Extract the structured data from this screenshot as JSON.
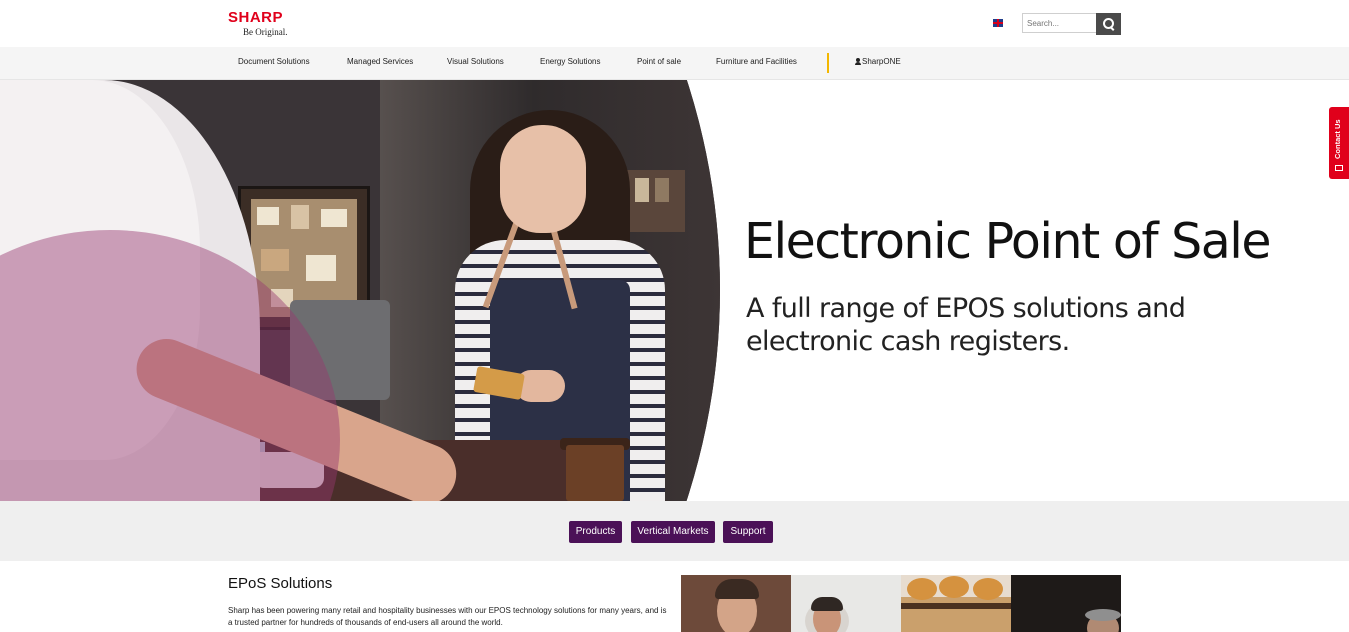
{
  "brand": {
    "name": "SHARP",
    "tagline": "Be Original."
  },
  "header": {
    "language_icon": "uk-flag-icon",
    "search": {
      "placeholder": "Search...",
      "value": "",
      "button_icon": "search-icon"
    }
  },
  "nav": {
    "items": [
      {
        "label": "Document Solutions"
      },
      {
        "label": "Managed Services"
      },
      {
        "label": "Visual Solutions"
      },
      {
        "label": "Energy Solutions"
      },
      {
        "label": "Point of sale"
      },
      {
        "label": "Furniture and Facilities"
      }
    ],
    "account_label": "SharpONE",
    "account_icon": "user-icon"
  },
  "hero": {
    "title": "Electronic Point of Sale",
    "subtitle": "A full range of EPOS solutions and electronic cash registers."
  },
  "contact_tab": {
    "label": "Contact Us",
    "icon": "mail-icon"
  },
  "section_tabs": [
    {
      "label": "Products"
    },
    {
      "label": "Vertical Markets"
    },
    {
      "label": "Support"
    }
  ],
  "content": {
    "title": "EPoS Solutions",
    "text": "Sharp has been powering many retail and hospitality businesses with our EPOS technology solutions for many years, and is a trusted partner for hundreds of thousands of end-users all around the world."
  },
  "colors": {
    "brand_red": "#e0001b",
    "tab_purple": "#4b1157",
    "nav_accent": "#f3b700"
  }
}
